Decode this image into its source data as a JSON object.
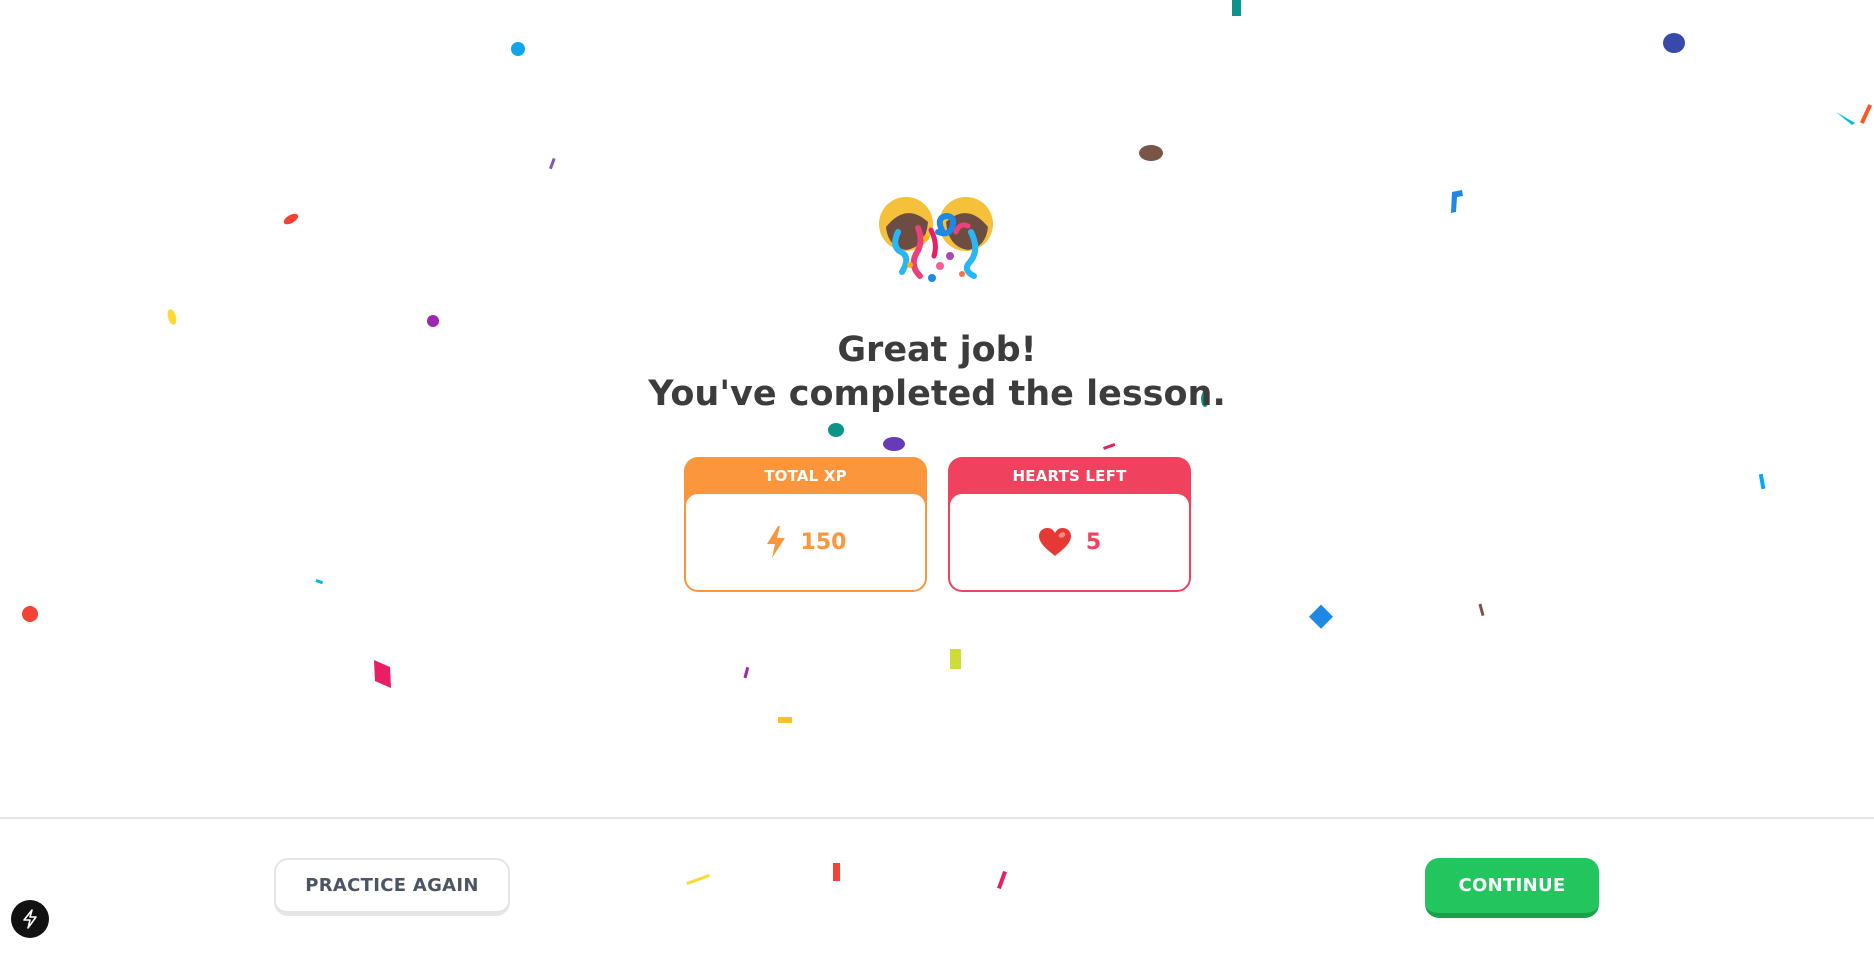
{
  "completion": {
    "title_line1": "Great job!",
    "title_line2": "You've completed the lesson."
  },
  "stats": {
    "xp": {
      "label": "TOTAL XP",
      "value": "150",
      "icon": "lightning-icon",
      "color": "#fb963c"
    },
    "hearts": {
      "label": "HEARTS LEFT",
      "value": "5",
      "icon": "heart-icon",
      "color": "#f0415f"
    }
  },
  "footer": {
    "practice_label": "PRACTICE AGAIN",
    "continue_label": "CONTINUE"
  },
  "colors": {
    "accent_green": "#22c55e",
    "xp_orange": "#fb963c",
    "hearts_red": "#f0415f"
  },
  "icons": {
    "hero": "party-popper-icon",
    "dev_badge": "lightning-icon"
  }
}
